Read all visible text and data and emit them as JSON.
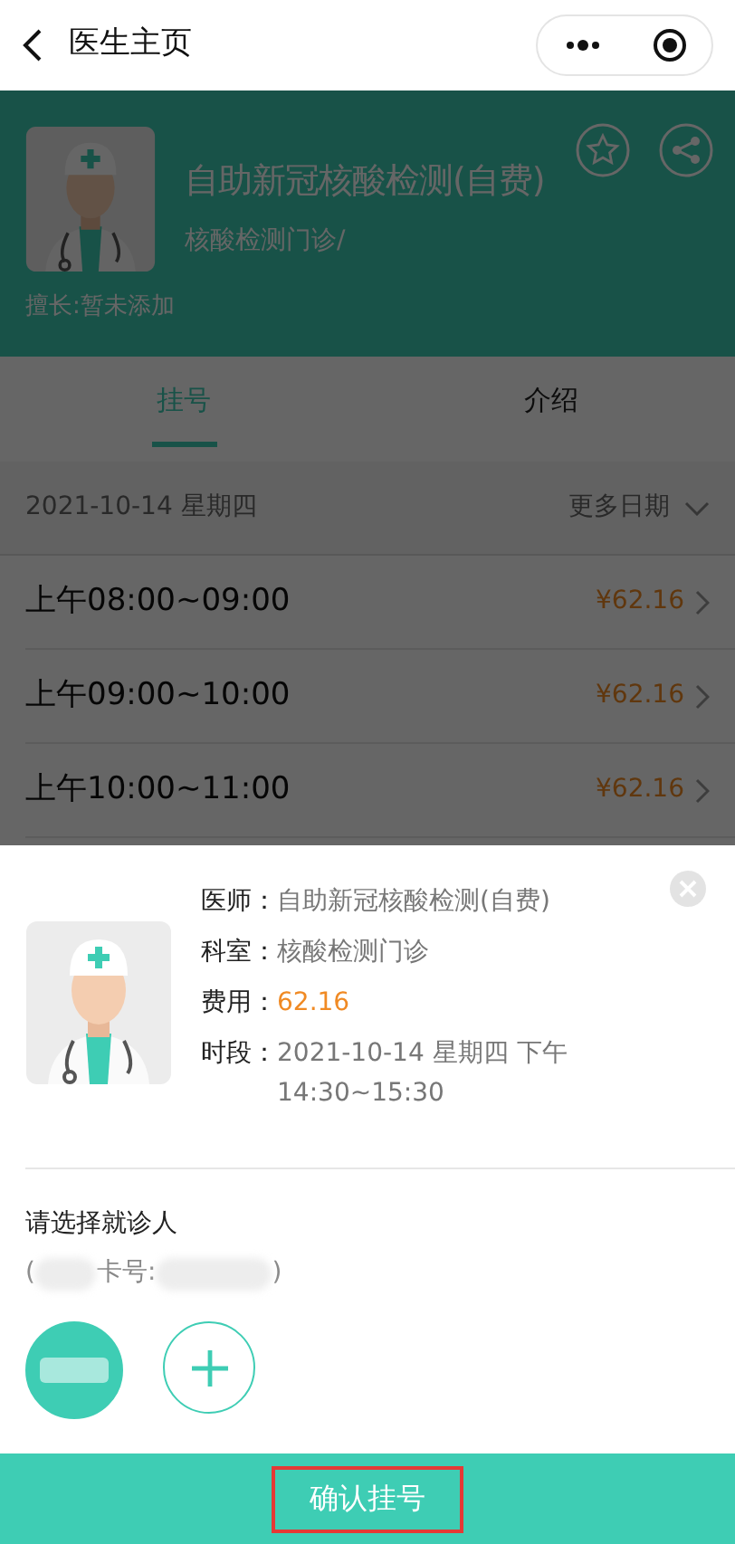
{
  "nav": {
    "title": "医生主页"
  },
  "doctor": {
    "name": "自助新冠核酸检测(自费)",
    "department": "核酸检测门诊/",
    "specialty": "擅长:暂未添加"
  },
  "tabs": [
    {
      "label": "挂号",
      "selected": true
    },
    {
      "label": "介绍",
      "selected": false
    }
  ],
  "date_bar": {
    "date": "2021-10-14 星期四",
    "more": "更多日期"
  },
  "slots": [
    {
      "time": "上午08:00~09:00",
      "price": "¥62.16"
    },
    {
      "time": "上午09:00~10:00",
      "price": "¥62.16"
    },
    {
      "time": "上午10:00~11:00",
      "price": "¥62.16"
    }
  ],
  "sheet": {
    "fields": [
      {
        "label": "医师：",
        "value": "自助新冠核酸检测(自费)",
        "kind": "plain"
      },
      {
        "label": "科室：",
        "value": "核酸检测门诊",
        "kind": "plain"
      },
      {
        "label": "费用：",
        "value": "62.16",
        "kind": "price"
      },
      {
        "label": "时段：",
        "value": "2021-10-14 星期四 下午 14:30~15:30",
        "kind": "plain"
      }
    ],
    "patient_prompt": "请选择就诊人",
    "card_open": "(",
    "card_label": "卡号:",
    "card_close": ")",
    "patients": [
      {
        "selected": true
      }
    ],
    "confirm": "确认挂号"
  }
}
